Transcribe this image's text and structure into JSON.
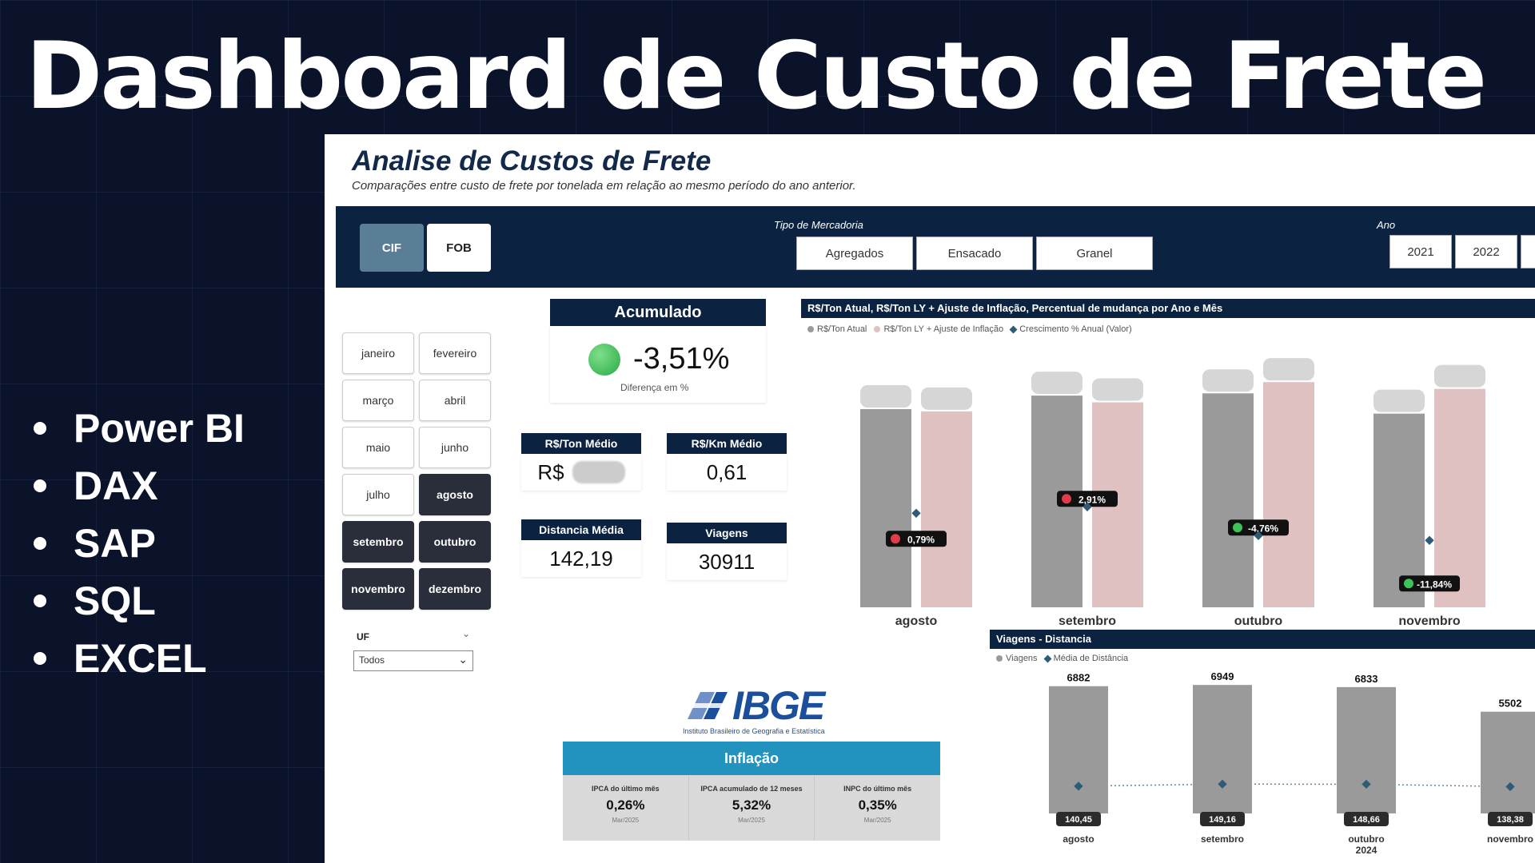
{
  "headline": "Dashboard de Custo de Frete",
  "technologies": [
    "Power BI",
    "DAX",
    "SAP",
    "SQL",
    "EXCEL"
  ],
  "dashboard": {
    "title": "Analise de Custos de Frete",
    "subtitle": "Comparações entre custo de frete por tonelada em relação ao mesmo período do ano anterior.",
    "filters": {
      "modal": [
        "CIF",
        "FOB"
      ],
      "selected_modal": "CIF",
      "tipo_mercadoria_label": "Tipo de Mercadoria",
      "tipo_mercadoria": [
        "Agregados",
        "Ensacado",
        "Granel"
      ],
      "ano_label": "Ano",
      "anos": [
        "2021",
        "2022"
      ]
    },
    "months": [
      {
        "label": "janeiro",
        "selected": false
      },
      {
        "label": "fevereiro",
        "selected": false
      },
      {
        "label": "março",
        "selected": false
      },
      {
        "label": "abril",
        "selected": false
      },
      {
        "label": "maio",
        "selected": false
      },
      {
        "label": "junho",
        "selected": false
      },
      {
        "label": "julho",
        "selected": false
      },
      {
        "label": "agosto",
        "selected": true
      },
      {
        "label": "setembro",
        "selected": true
      },
      {
        "label": "outubro",
        "selected": true
      },
      {
        "label": "novembro",
        "selected": true
      },
      {
        "label": "dezembro",
        "selected": true
      }
    ],
    "uf": {
      "label": "UF",
      "value": "Todos"
    },
    "acumulado": {
      "title": "Acumulado",
      "value": "-3,51%",
      "sub": "Diferença em %",
      "status_color": "#2aa845"
    },
    "kpis": {
      "ton_medio": {
        "label": "R$/Ton Médio",
        "value": "R$"
      },
      "km_medio": {
        "label": "R$/Km Médio",
        "value": "0,61"
      },
      "distancia": {
        "label": "Distancia Média",
        "value": "142,19"
      },
      "viagens": {
        "label": "Viagens",
        "value": "30911"
      }
    },
    "inflacao": {
      "logo_text": "IBGE",
      "logo_sub": "Instituto Brasileiro de Geografia e Estatística",
      "title": "Inflação",
      "items": [
        {
          "label": "IPCA do último mês",
          "value": "0,26%",
          "date": "Mar/2025"
        },
        {
          "label": "IPCA acumulado de 12 meses",
          "value": "5,32%",
          "date": "Mar/2025"
        },
        {
          "label": "INPC do último mês",
          "value": "0,35%",
          "date": "Mar/2025"
        }
      ]
    }
  },
  "chart_data": [
    {
      "type": "bar",
      "title": "R$/Ton Atual, R$/Ton LY + Ajuste de Inflação, Percentual de mudança por Ano e Mês",
      "legend": [
        "R$/Ton Atual",
        "R$/Ton LY + Ajuste de Inflação",
        "Crescimento % Anual (Valor)"
      ],
      "categories": [
        "agosto",
        "setembro",
        "outubro",
        "novembro"
      ],
      "series": [
        {
          "name": "R$/Ton Atual",
          "values": [
            88,
            94,
            95,
            86
          ],
          "color": "#9a9a9a"
        },
        {
          "name": "R$/Ton LY + Ajuste de Inflação",
          "values": [
            87,
            91,
            100,
            97
          ],
          "color": "#e0c1c1"
        }
      ],
      "growth_labels": [
        "0,79%",
        "2,91%",
        "-4,76%",
        "-11,84%"
      ],
      "growth_status": [
        "red",
        "red",
        "green",
        "green"
      ],
      "colors": {
        "atual": "#9a9a9a",
        "ly": "#e0c1c1",
        "marker": "#2e5b78",
        "red": "#e23b4a",
        "green": "#3cc35a"
      },
      "ylim": [
        0,
        110
      ]
    },
    {
      "type": "bar",
      "title": "Viagens - Distancia",
      "legend": [
        "Viagens",
        "Média de Distância"
      ],
      "categories": [
        "agosto",
        "setembro",
        "outubro",
        "novembro"
      ],
      "year_label": "2024",
      "year_under": "outubro",
      "series": [
        {
          "name": "Viagens",
          "values": [
            6882,
            6949,
            6833,
            5502
          ],
          "color": "#9a9a9a"
        },
        {
          "name": "Média de Distância",
          "values": [
            140.45,
            149.16,
            148.66,
            138.38
          ],
          "labels": [
            "140,45",
            "149,16",
            "148,66",
            "138,38"
          ],
          "color": "#2e5b78"
        }
      ],
      "ylim": [
        0,
        7000
      ]
    }
  ]
}
